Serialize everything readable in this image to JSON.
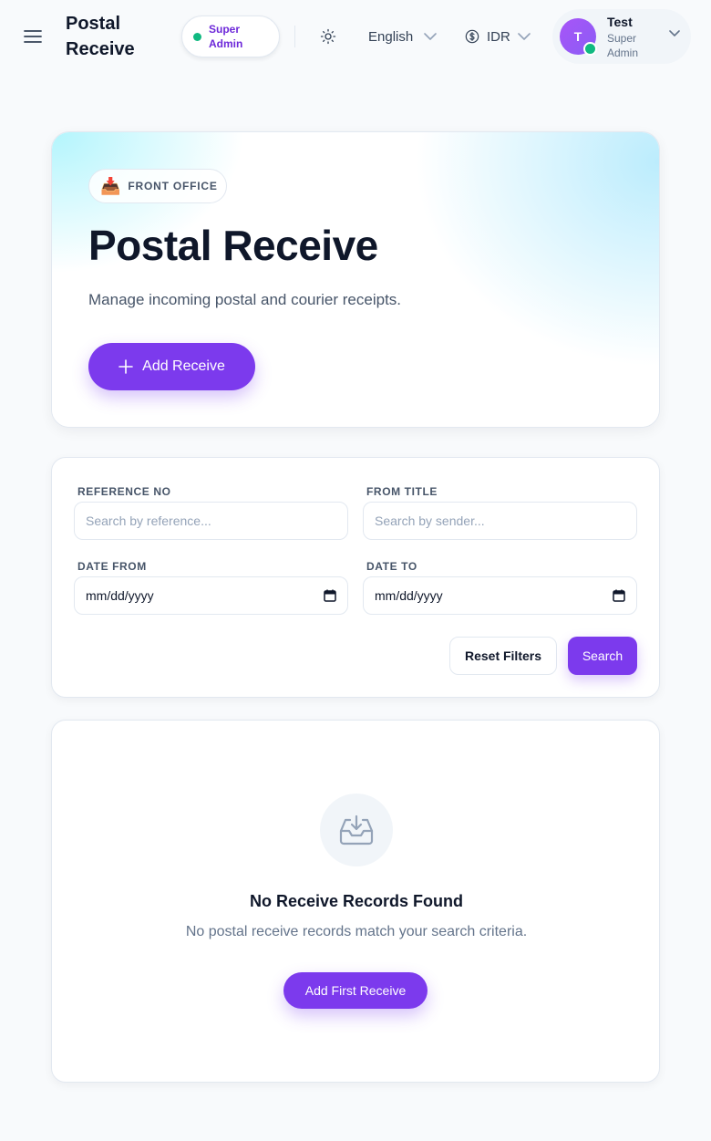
{
  "header": {
    "app_title": "Postal Receive",
    "role_badge": "Super Admin",
    "language": "English",
    "currency": "IDR",
    "user": {
      "initial": "T",
      "name": "Test",
      "role": "Super Admin"
    }
  },
  "hero": {
    "badge_icon": "📥",
    "badge": "FRONT OFFICE",
    "title": "Postal Receive",
    "subtitle": "Manage incoming postal and courier receipts.",
    "add_button": "Add Receive"
  },
  "filters": {
    "reference_label": "REFERENCE NO",
    "reference_placeholder": "Search by reference...",
    "from_label": "FROM TITLE",
    "from_placeholder": "Search by sender...",
    "date_from_label": "DATE FROM",
    "date_from_value": "mm/dd/yyyy",
    "date_to_label": "DATE TO",
    "date_to_value": "mm/dd/yyyy",
    "reset_button": "Reset Filters",
    "search_button": "Search"
  },
  "empty_state": {
    "title": "No Receive Records Found",
    "text": "No postal receive records match your search criteria.",
    "button": "Add First Receive"
  },
  "colors": {
    "accent": "#7c3aed",
    "online": "#10b981"
  }
}
